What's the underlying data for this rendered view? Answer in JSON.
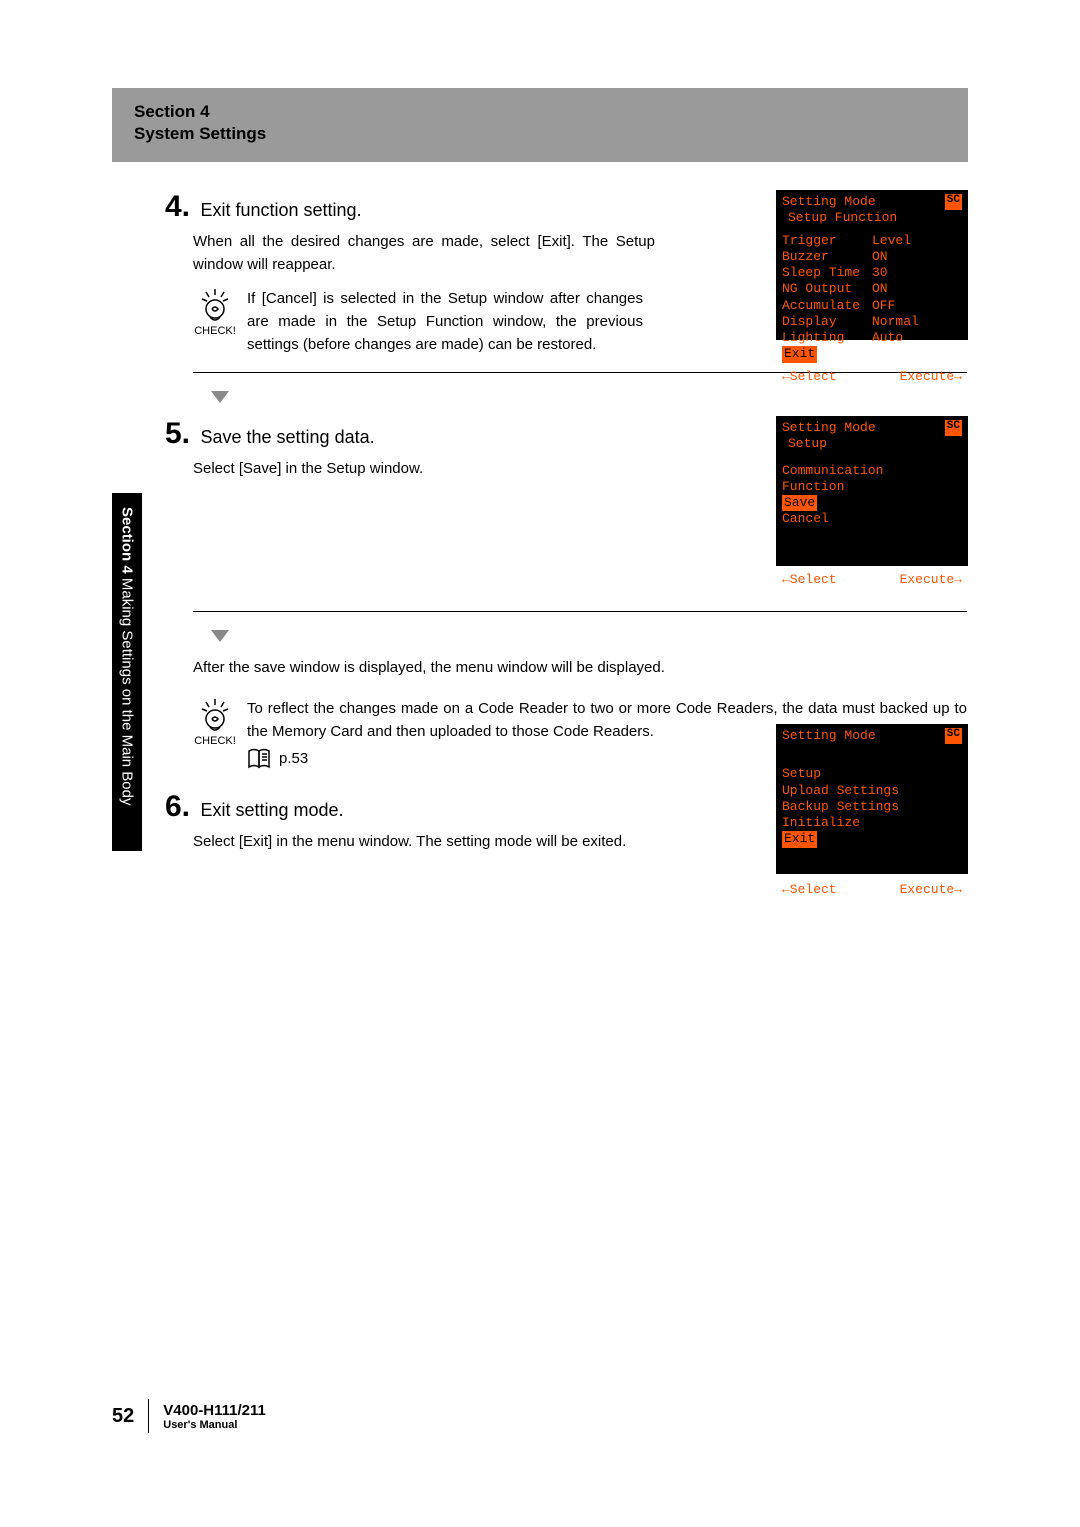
{
  "header": {
    "section_line": "Section 4",
    "title": "System Settings"
  },
  "side_tab": {
    "bold": "Section 4",
    "rest": " Making Settings on the Main Body"
  },
  "steps": {
    "s4": {
      "num": "4.",
      "title": "Exit function setting.",
      "body": "When all the desired changes are made, select [Exit]. The Setup window will reappear.",
      "check_text": "If [Cancel] is selected in the Setup window after changes are made in the Setup Function window, the previous settings (before changes are made) can be restored."
    },
    "s5": {
      "num": "5.",
      "title": "Save the setting data.",
      "body": "Select [Save] in the Setup window.",
      "after": "After the save window is displayed, the menu window will be displayed.",
      "check_text": "To reflect the changes made on a Code Reader to two or more Code Readers, the data must backed up to the Memory Card and then uploaded to those Code Readers.",
      "page_ref": "p.53"
    },
    "s6": {
      "num": "6.",
      "title": "Exit setting mode.",
      "body": "Select [Exit] in the menu window. The setting mode will be exited."
    }
  },
  "check_label": "CHECK!",
  "screens": {
    "s1": {
      "mode": "Setting Mode",
      "subtitle": "Setup Function",
      "rows": [
        {
          "k": "Trigger",
          "v": "Level"
        },
        {
          "k": "Buzzer",
          "v": "ON"
        },
        {
          "k": "Sleep Time",
          "v": "30"
        },
        {
          "k": "NG Output",
          "v": "ON"
        },
        {
          "k": "Accumulate",
          "v": "OFF"
        },
        {
          "k": "Display",
          "v": "Normal"
        },
        {
          "k": "Lighting",
          "v": "Auto"
        }
      ],
      "highlight": "Exit",
      "foot_l": "←Select",
      "foot_r": "Execute→",
      "sc": "SC"
    },
    "s2": {
      "mode": "Setting Mode",
      "subtitle": "Setup",
      "items": [
        "Communication",
        "Function"
      ],
      "highlight": "Save",
      "after": [
        "Cancel"
      ],
      "foot_l": "←Select",
      "foot_r": "Execute→",
      "sc": "SC"
    },
    "s3": {
      "mode": "Setting Mode",
      "items": [
        "Setup",
        "Upload Settings",
        "Backup Settings",
        "Initialize"
      ],
      "highlight": "Exit",
      "foot_l": "←Select",
      "foot_r": "Execute→",
      "sc": "SC"
    }
  },
  "footer": {
    "page": "52",
    "model": "V400-H111/211",
    "manual": "User's Manual"
  }
}
